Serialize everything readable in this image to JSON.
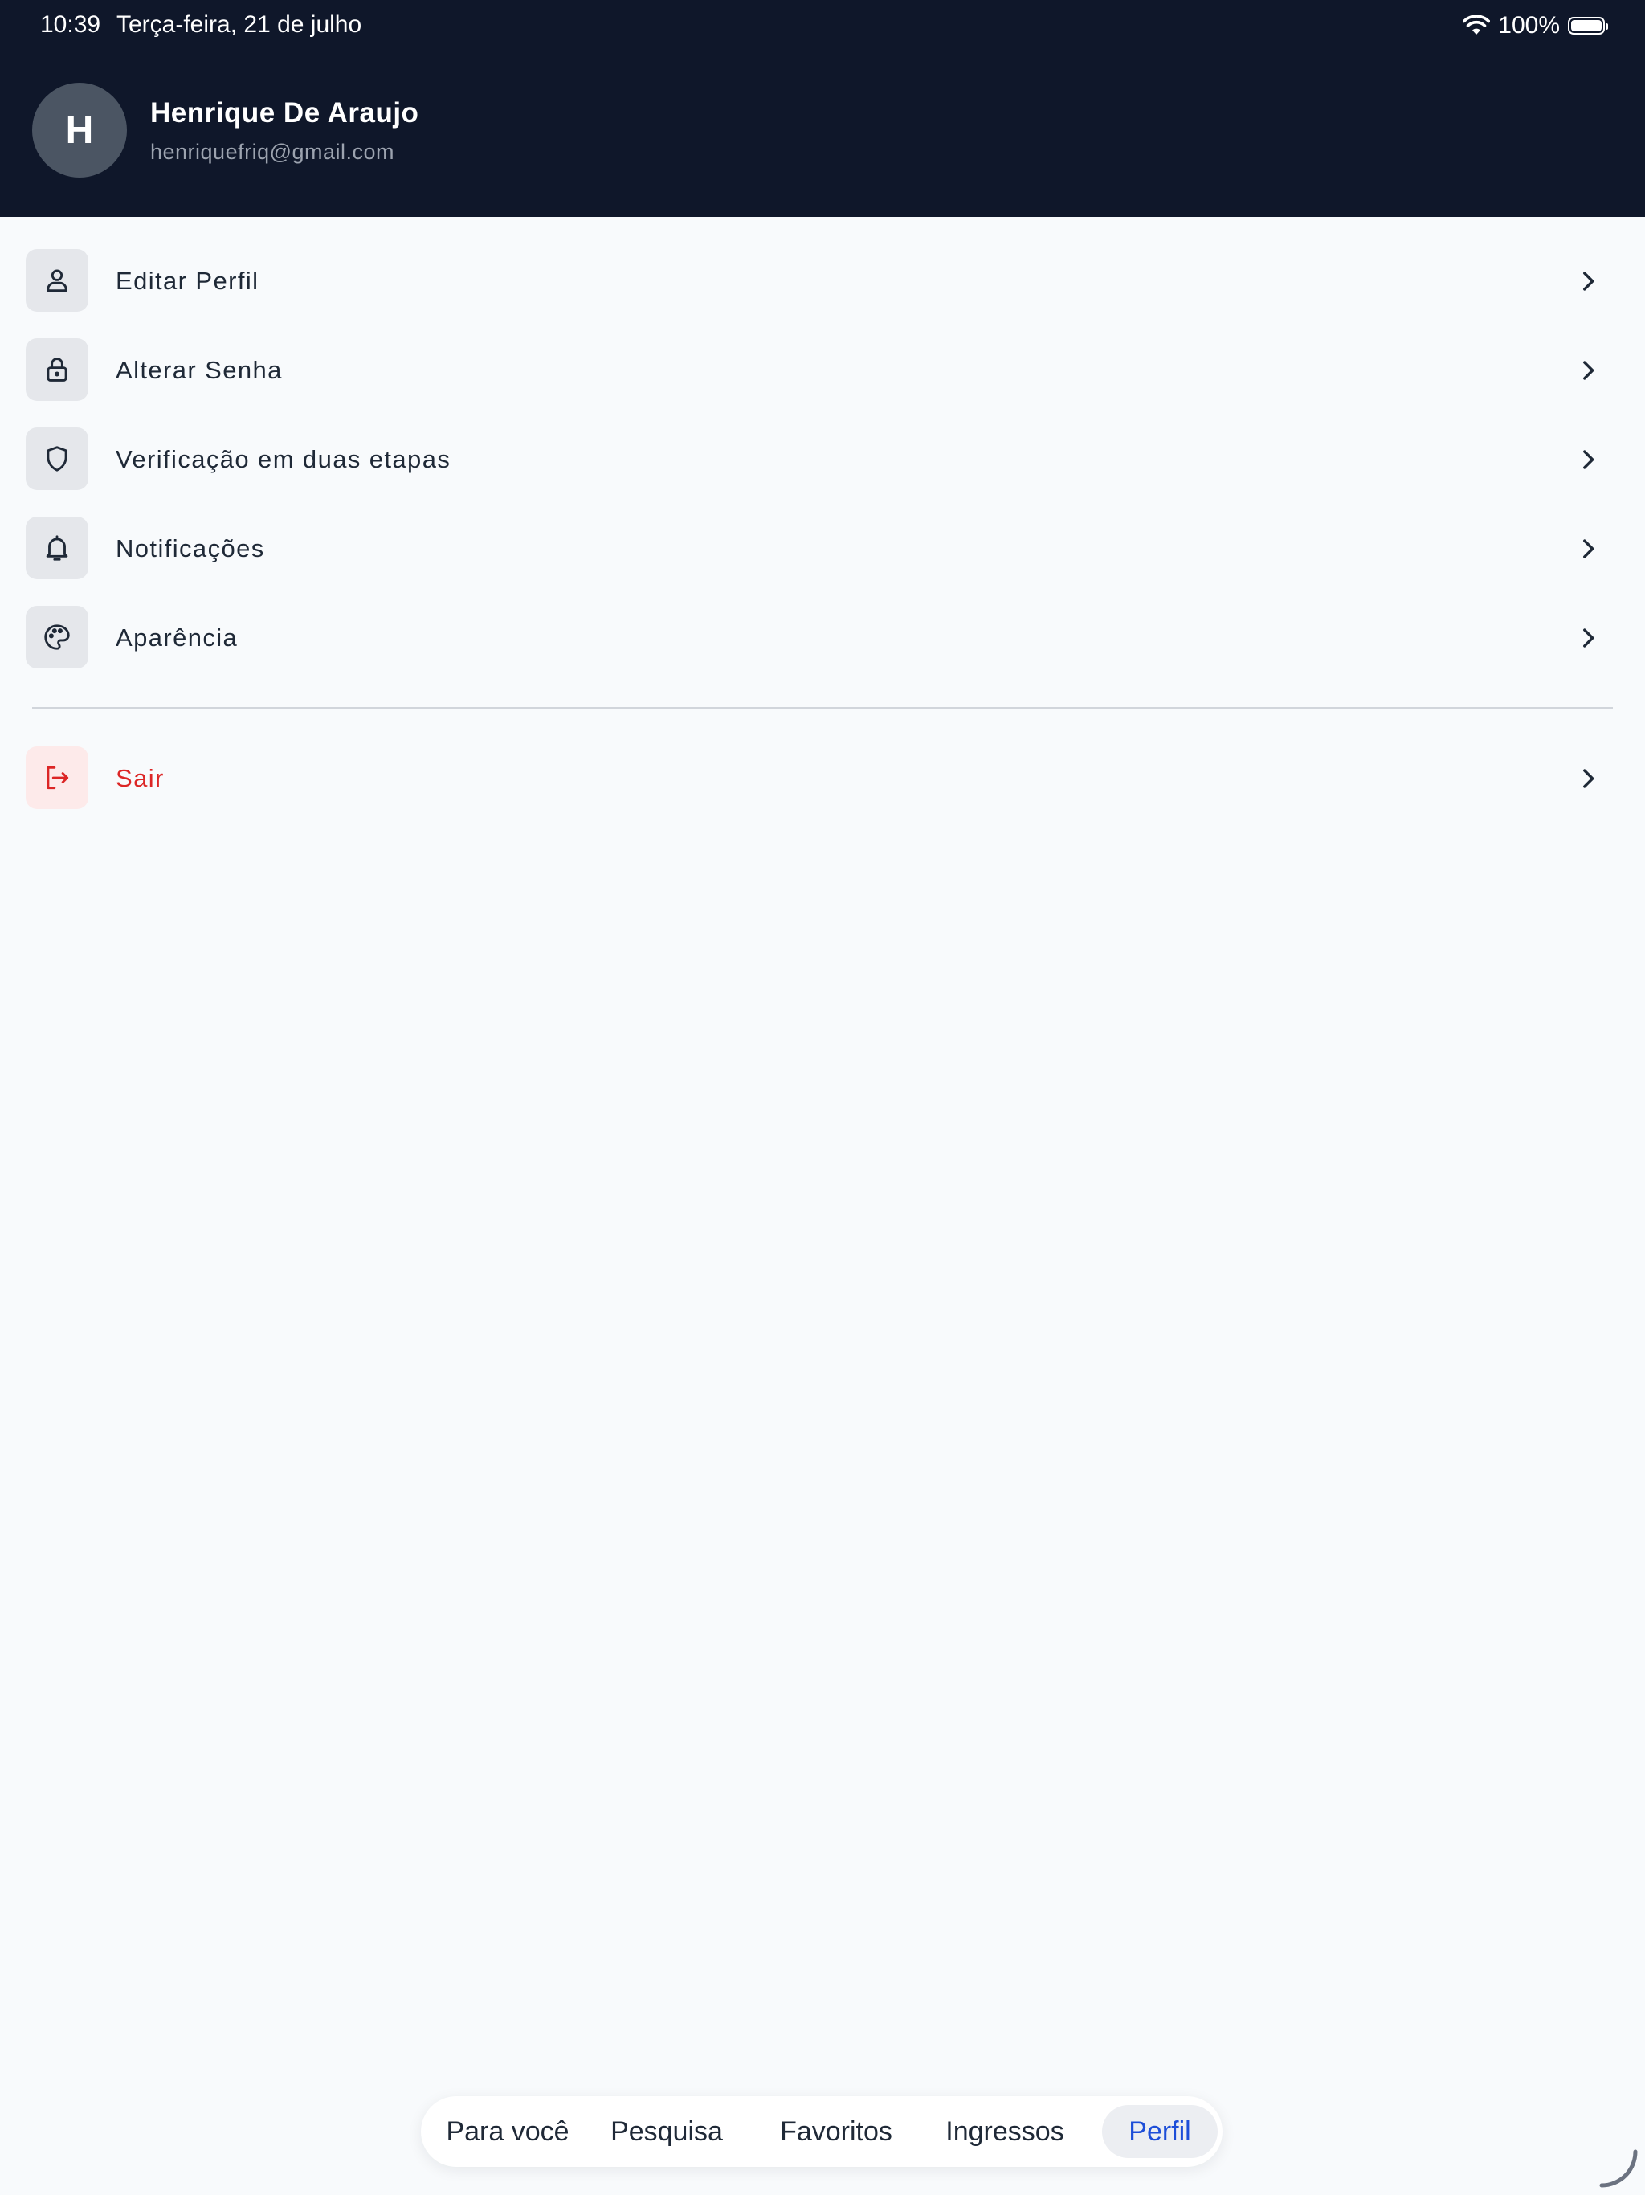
{
  "status_bar": {
    "time": "10:39",
    "date": "Terça-feira, 21 de julho",
    "battery": "100%"
  },
  "profile": {
    "initial": "H",
    "name": "Henrique De Araujo",
    "email": "henriquefriq@gmail.com"
  },
  "menu": {
    "items": [
      {
        "label": "Editar Perfil",
        "icon": "user-icon"
      },
      {
        "label": "Alterar Senha",
        "icon": "lock-icon"
      },
      {
        "label": "Verificação em duas etapas",
        "icon": "shield-icon"
      },
      {
        "label": "Notificações",
        "icon": "bell-icon"
      },
      {
        "label": "Aparência",
        "icon": "palette-icon"
      }
    ],
    "logout": {
      "label": "Sair",
      "icon": "logout-icon"
    }
  },
  "tabs": [
    {
      "label": "Para você",
      "active": false
    },
    {
      "label": "Pesquisa",
      "active": false
    },
    {
      "label": "Favoritos",
      "active": false
    },
    {
      "label": "Ingressos",
      "active": false
    },
    {
      "label": "Perfil",
      "active": true
    }
  ],
  "colors": {
    "header_bg": "#0f172a",
    "page_bg": "#f8fafc",
    "accent": "#1d4ed8",
    "danger": "#dc2626"
  }
}
